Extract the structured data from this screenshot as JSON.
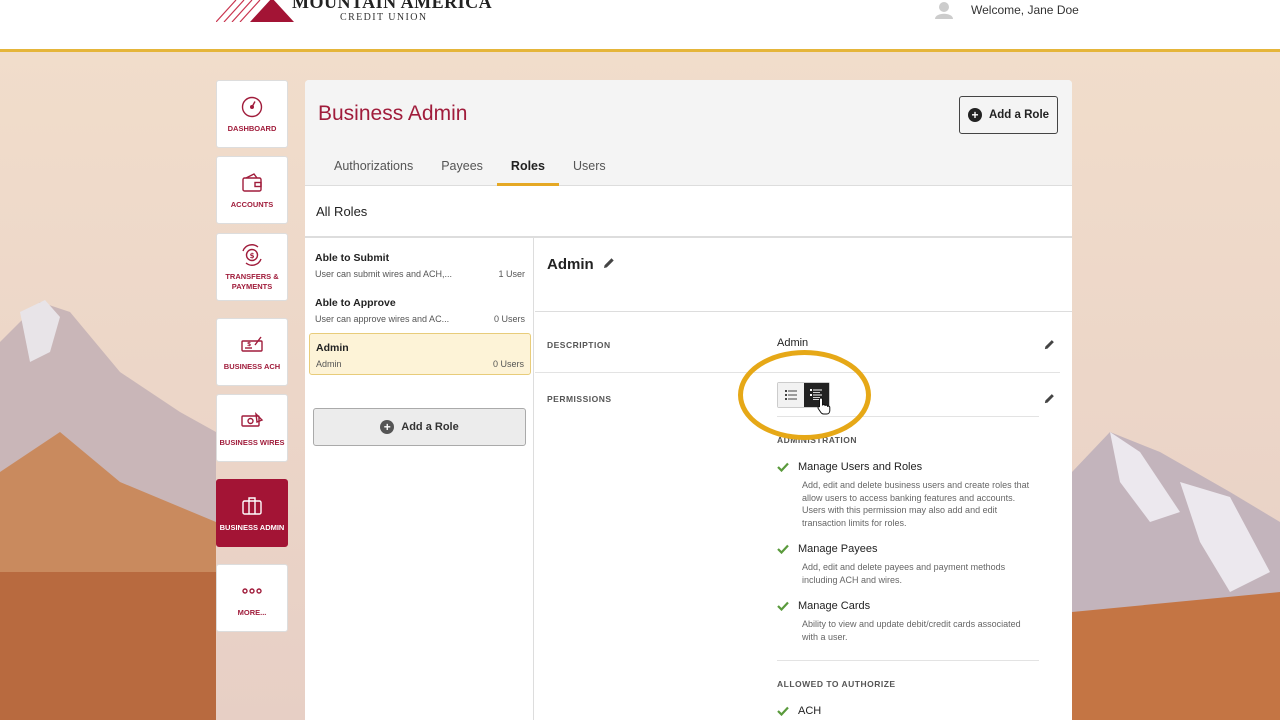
{
  "header": {
    "logo_name": "MOUNTAIN AMERICA",
    "logo_sub": "CREDIT UNION",
    "welcome": "Welcome, Jane Doe"
  },
  "colors": {
    "brand": "#a31435",
    "accent": "#e5a824",
    "check": "#5a9a3c"
  },
  "nav": {
    "items": [
      {
        "label": "DASHBOARD",
        "icon": "gauge-icon"
      },
      {
        "label": "ACCOUNTS",
        "icon": "wallet-icon"
      },
      {
        "label": "TRANSFERS & PAYMENTS",
        "icon": "transfer-icon"
      },
      {
        "label": "BUSINESS ACH",
        "icon": "check-document-icon"
      },
      {
        "label": "BUSINESS WIRES",
        "icon": "wire-money-icon"
      },
      {
        "label": "BUSINESS ADMIN",
        "icon": "briefcase-icon",
        "active": true
      },
      {
        "label": "MORE...",
        "icon": "more-dots-icon"
      }
    ]
  },
  "main": {
    "title": "Business Admin",
    "add_role_label": "Add a Role",
    "tabs": [
      {
        "label": "Authorizations"
      },
      {
        "label": "Payees"
      },
      {
        "label": "Roles",
        "active": true
      },
      {
        "label": "Users"
      }
    ],
    "section_title": "All Roles",
    "roles": [
      {
        "name": "Able to Submit",
        "desc": "User can submit wires and ACH,...",
        "count": "1 User"
      },
      {
        "name": "Able to Approve",
        "desc": "User can approve wires and AC...",
        "count": "0 Users"
      },
      {
        "name": "Admin",
        "desc": "Admin",
        "count": "0 Users",
        "active": true
      }
    ],
    "add_role_list_label": "Add a Role"
  },
  "detail": {
    "title": "Admin",
    "description_label": "DESCRIPTION",
    "description_value": "Admin",
    "permissions_label": "PERMISSIONS",
    "section_administration": "ADMINISTRATION",
    "permissions": [
      {
        "name": "Manage Users and Roles",
        "desc": "Add, edit and delete business users and create roles that allow users to access banking features and accounts. Users with this permission may also add and edit transaction limits for roles."
      },
      {
        "name": "Manage Payees",
        "desc": "Add, edit and delete payees and payment methods including ACH and wires."
      },
      {
        "name": "Manage Cards",
        "desc": "Ability to view and update debit/credit cards associated with a user."
      }
    ],
    "section_allowed": "ALLOWED TO AUTHORIZE",
    "authorize_items": [
      {
        "name": "ACH"
      }
    ]
  }
}
